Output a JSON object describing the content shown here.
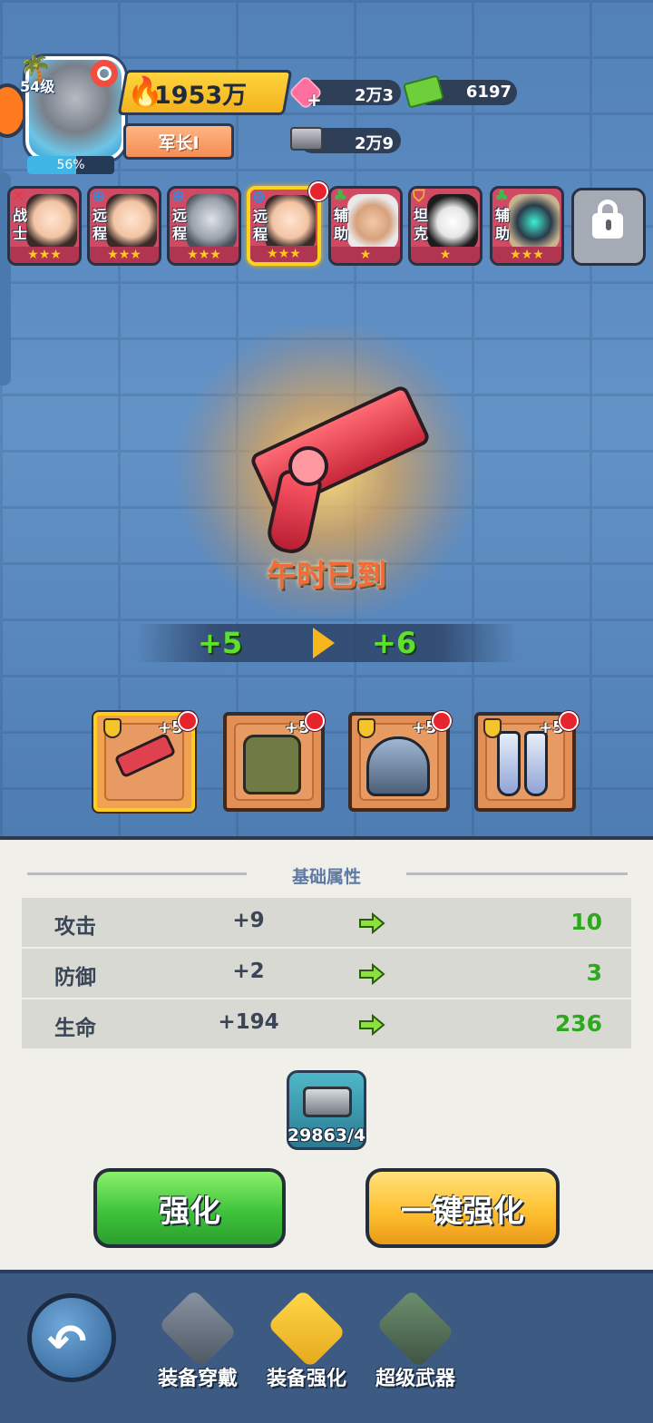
{
  "player": {
    "level": "54级",
    "xp_percent": "56%",
    "xp_fraction": 0.56,
    "power": "1953万",
    "rank": "军长Ⅰ"
  },
  "resources": {
    "gems": "2万3",
    "cash": "6197",
    "ingots": "2万9"
  },
  "heroes": [
    {
      "role": "战士",
      "stars": "★★★",
      "type_icon": "sword-icon"
    },
    {
      "role": "远程",
      "stars": "★★★",
      "type_icon": "crosshair-icon"
    },
    {
      "role": "远程",
      "stars": "★★★",
      "type_icon": "crosshair-icon"
    },
    {
      "role": "远程",
      "stars": "★★★",
      "type_icon": "crosshair-icon",
      "selected": true
    },
    {
      "role": "辅助",
      "stars": "★",
      "type_icon": "clover-icon"
    },
    {
      "role": "坦克",
      "stars": "★",
      "type_icon": "shield-icon"
    },
    {
      "role": "辅助",
      "stars": "★★★",
      "type_icon": "clover-icon"
    }
  ],
  "weapon": {
    "name": "午时已到",
    "level_from": "+5",
    "level_to": "+6"
  },
  "equipment": [
    {
      "plus": "+5",
      "slot": "weapon"
    },
    {
      "plus": "+5",
      "slot": "armor"
    },
    {
      "plus": "+5",
      "slot": "helmet"
    },
    {
      "plus": "+5",
      "slot": "boots"
    }
  ],
  "attributes": {
    "title": "基础属性",
    "rows": [
      {
        "name": "攻击",
        "current": "+9",
        "next": "10"
      },
      {
        "name": "防御",
        "current": "+2",
        "next": "3"
      },
      {
        "name": "生命",
        "current": "+194",
        "next": "236"
      }
    ]
  },
  "cost": "29863/4",
  "buttons": {
    "upgrade": "强化",
    "upgrade_all": "一键强化"
  },
  "nav": {
    "items": [
      "装备穿戴",
      "装备强化",
      "超级武器"
    ]
  },
  "colors": {
    "accent_green": "#3fc33c",
    "accent_yellow": "#ffc031",
    "next_value_green": "#2ea81e"
  }
}
